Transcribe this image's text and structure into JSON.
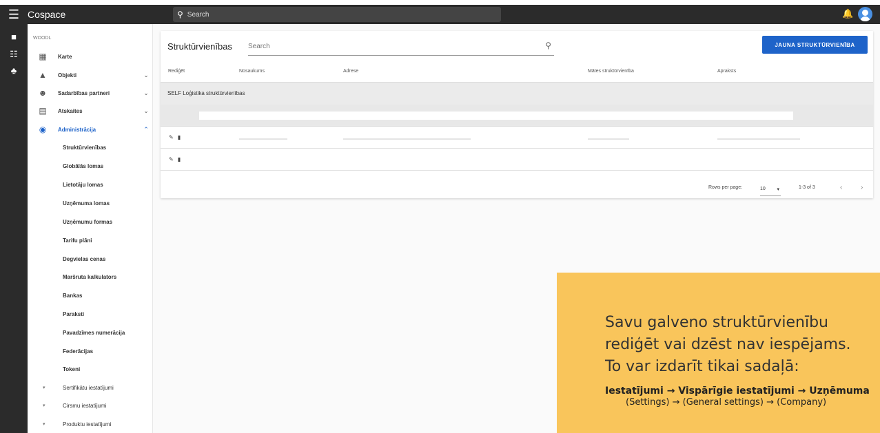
{
  "app": {
    "title": "Cospace",
    "search_placeholder": "Search"
  },
  "sidebar": {
    "org": "WOODL",
    "items": [
      {
        "label": "Karte",
        "icon": "map-icon"
      },
      {
        "label": "Objekti",
        "icon": "forest-icon"
      },
      {
        "label": "Sadarbības partneri",
        "icon": "people-icon"
      },
      {
        "label": "Atskaites",
        "icon": "report-icon"
      },
      {
        "label": "Administrācija",
        "icon": "account-icon"
      }
    ],
    "admin_sub": [
      "Struktūrvienības",
      "Globālās lomas",
      "Lietotāju lomas",
      "Uzņēmuma lomas",
      "Uzņēmumu formas",
      "Tarifu plāni",
      "Degvielas cenas",
      "Maršruta kalkulators",
      "Bankas",
      "Paraksti",
      "Pavadzīmes numerācija",
      "Federācijas",
      "Tokeni"
    ],
    "collapsed": [
      "Sertifikātu iestatījumi",
      "Cirsmu iestatījumi",
      "Produktu iestatījumi"
    ]
  },
  "card": {
    "title": "Struktūrvienības",
    "search_placeholder": "Search",
    "new_button": "JAUNA STRUKTŪRVIENĪBA",
    "columns": [
      "Rediģēt",
      "Nosaukums",
      "Adrese",
      "Mātes struktūrvienība",
      "Apraksts"
    ],
    "group_label": "SELF Loģistika struktūrvienības",
    "rows_per_page_label": "Rows per page:",
    "rows_per_page": "10",
    "range": "1-3 of 3"
  },
  "note": {
    "line1": "Savu galveno struktūrvienību",
    "line2": "rediģēt vai dzēst nav iespējams.",
    "line3": "To var izdarīt tikai sadaļā:",
    "path": "Iestatījumi → Vispārīgie iestatījumi → Uzņēmuma",
    "path_en": "(Settings) → (General settings) → (Company)"
  },
  "colors": {
    "accent": "#1e63c9",
    "topbar": "#2b2b2b",
    "note_bg": "#f9c55b"
  }
}
